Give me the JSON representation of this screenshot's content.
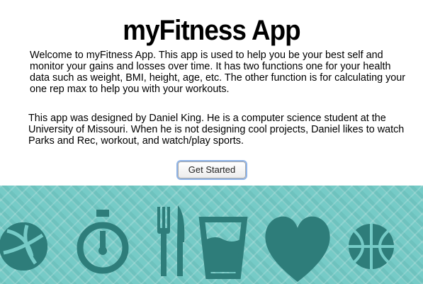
{
  "header": {
    "title": "myFitness App"
  },
  "main": {
    "intro": "Welcome to myFitness App. This app is used to help you be your best self and monitor your gains and losses over time. It has two functions one for your health data such as weight, BMI, height, age, etc. The other function is for calculating your one rep max to help you with your workouts.",
    "about": "This app was designed by Daniel King. He is a computer science student at the University of Missouri. When he is not designing cool projects, Daniel likes to watch Parks and Rec, workout, and watch/play sports.",
    "get_started_label": "Get Started"
  },
  "banner": {
    "icons": [
      "volleyball-icon",
      "stopwatch-icon",
      "fork-knife-icon",
      "water-glass-icon",
      "heart-icon",
      "basketball-icon"
    ],
    "colors": {
      "background": "#76cbc7",
      "icon": "#2e7d7a"
    }
  }
}
